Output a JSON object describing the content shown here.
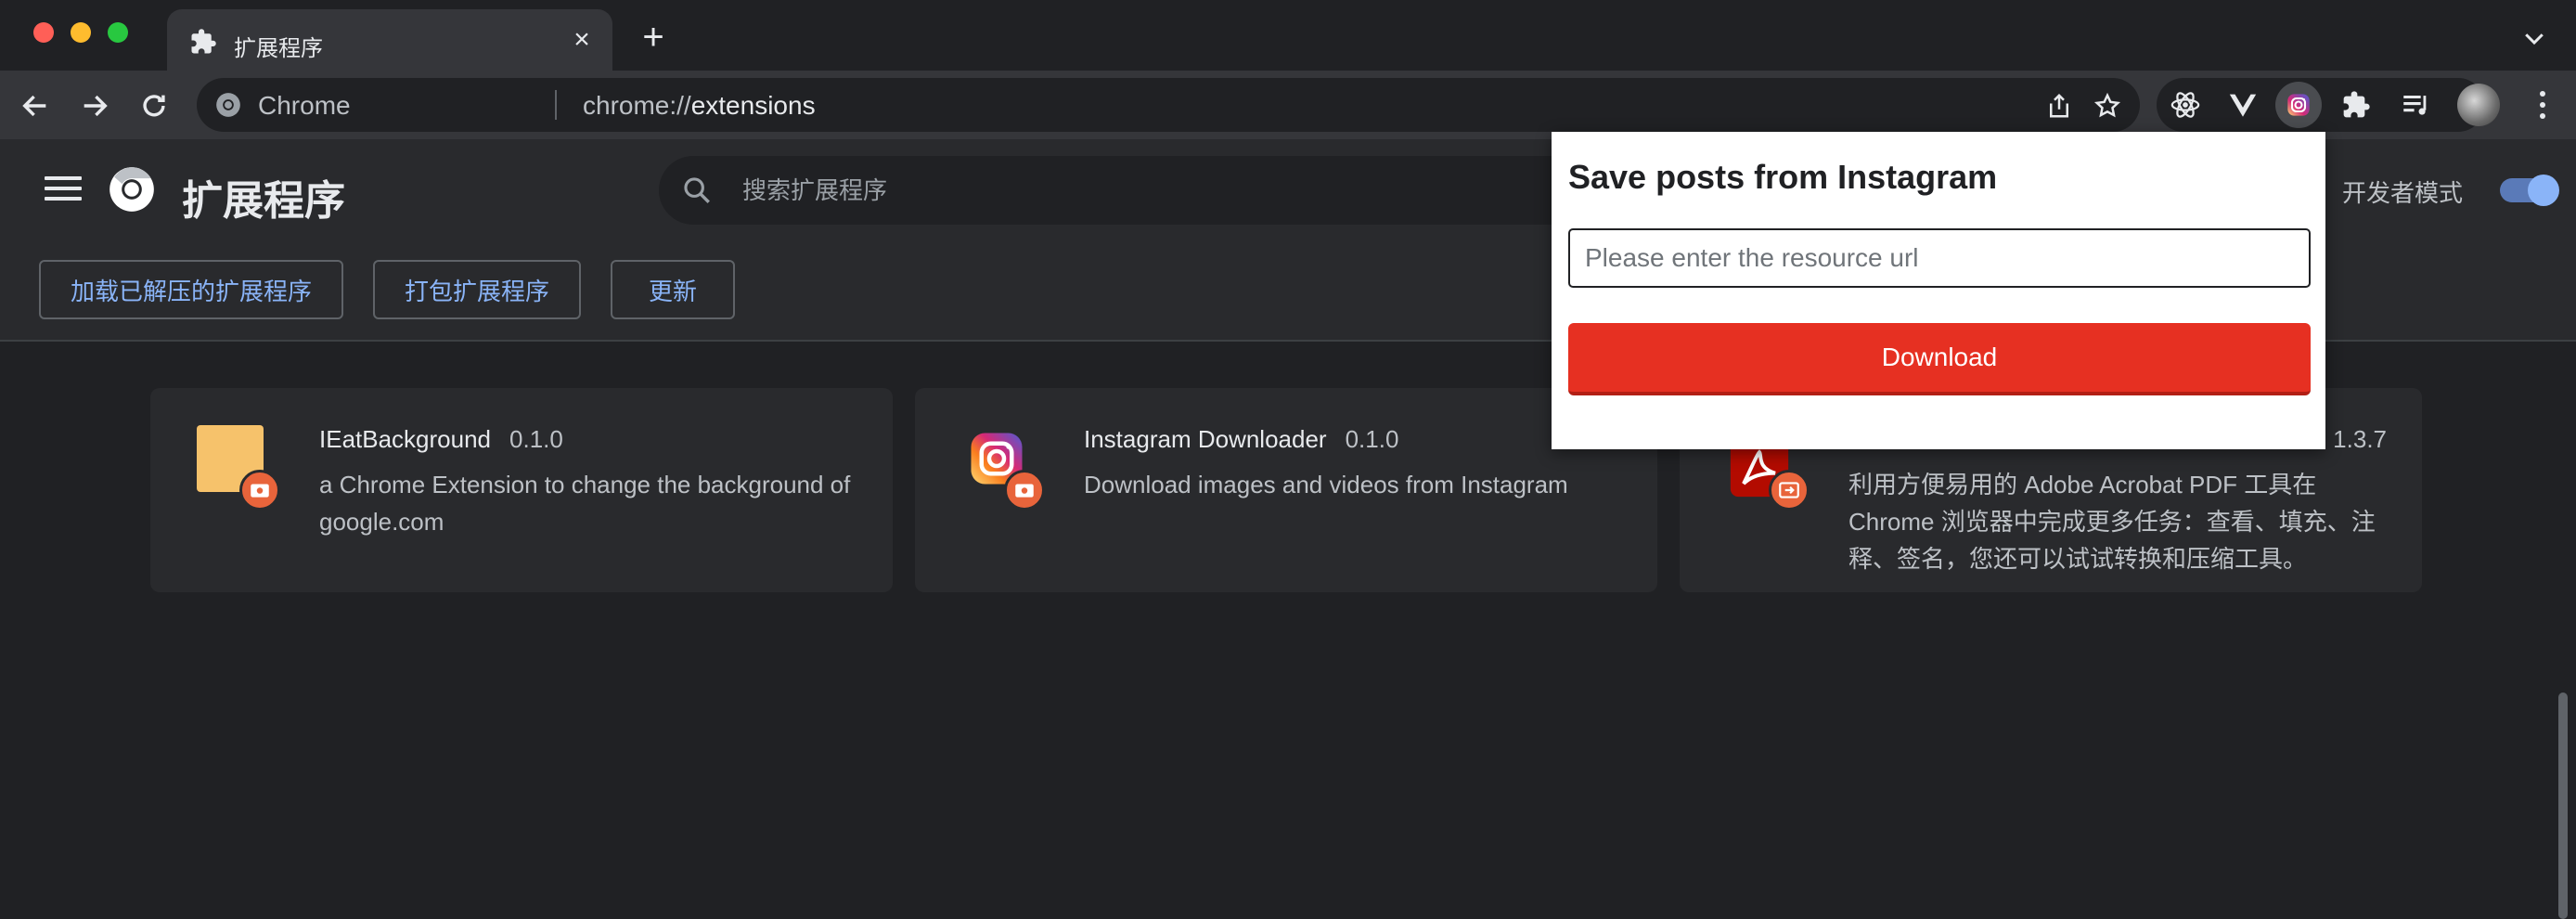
{
  "window": {
    "tab": {
      "title": "扩展程序",
      "icon": "puzzle-icon"
    },
    "new_tab_label": "+"
  },
  "toolbar": {
    "site_name": "Chrome",
    "url_prefix": "chrome://",
    "url_path": "extensions",
    "extensions": [
      "react-icon",
      "vue-icon",
      "instagram-icon",
      "puzzle-icon"
    ],
    "active_extension": "instagram-icon"
  },
  "header": {
    "title": "扩展程序",
    "search_placeholder": "搜索扩展程序",
    "dev_mode_label": "开发者模式",
    "dev_mode_on": true
  },
  "actions": {
    "load_unpacked": "加载已解压的扩展程序",
    "pack": "打包扩展程序",
    "update": "更新"
  },
  "cards": [
    {
      "name": "IEatBackground",
      "version": "0.1.0",
      "description": "a Chrome Extension to change the background of google.com",
      "icon": "yellow-square-icon"
    },
    {
      "name": "Instagram Downloader",
      "version": "0.1.0",
      "description": "Download images and videos from Instagram",
      "icon": "instagram-icon"
    },
    {
      "name": "",
      "version": "1.3.7",
      "description": "利用方便易用的 Adobe Acrobat PDF 工具在 Chrome 浏览器中完成更多任务：查看、填充、注释、签名，您还可以试试转换和压缩工具。",
      "icon": "adobe-acrobat-icon"
    }
  ],
  "popup": {
    "title": "Save posts from Instagram",
    "input_placeholder": "Please enter the resource url",
    "button_label": "Download"
  },
  "colors": {
    "accent": "#8ab4f8",
    "download_button": "#e63022",
    "background": "#202124"
  }
}
